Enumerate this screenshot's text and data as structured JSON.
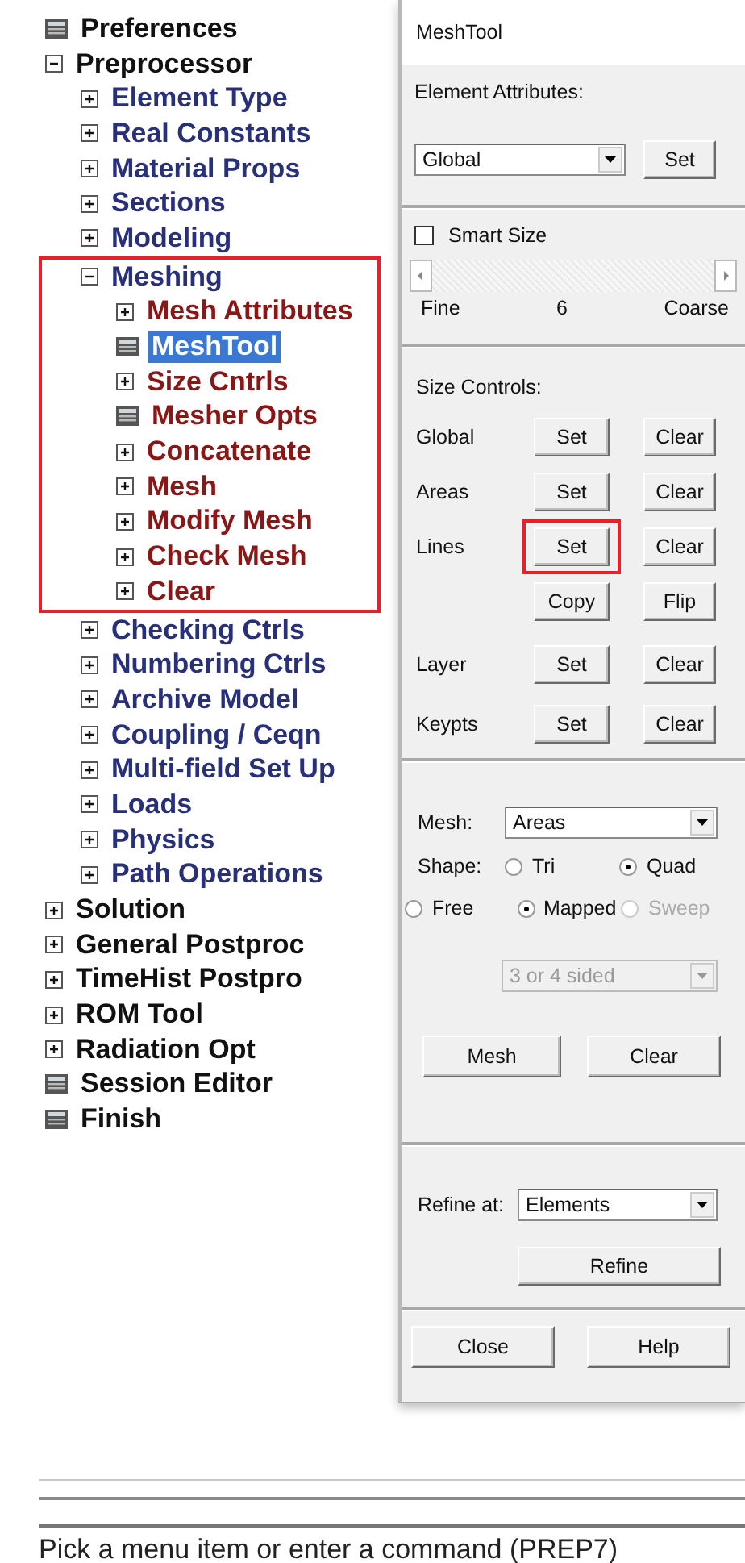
{
  "tree": [
    {
      "label": "Preferences",
      "kind": "dialog",
      "selected": false,
      "highlighted": false
    },
    {
      "label": "Preprocessor",
      "kind": "expander",
      "expanded": true,
      "selected": false,
      "highlighted": false,
      "children": [
        {
          "label": "Element Type",
          "kind": "expander",
          "expanded": false,
          "selected": false,
          "highlighted": false
        },
        {
          "label": "Real Constants",
          "kind": "expander",
          "expanded": false,
          "selected": false,
          "highlighted": false
        },
        {
          "label": "Material Props",
          "kind": "expander",
          "expanded": false,
          "selected": false,
          "highlighted": false
        },
        {
          "label": "Sections",
          "kind": "expander",
          "expanded": false,
          "selected": false,
          "highlighted": false
        },
        {
          "label": "Modeling",
          "kind": "expander",
          "expanded": false,
          "selected": false,
          "highlighted": false
        },
        {
          "label": "Meshing",
          "kind": "expander",
          "expanded": true,
          "selected": false,
          "highlighted": true,
          "children": [
            {
              "label": "Mesh Attributes",
              "kind": "expander",
              "expanded": false,
              "selected": false,
              "highlighted": false
            },
            {
              "label": "MeshTool",
              "kind": "dialog",
              "selected": true,
              "highlighted": false
            },
            {
              "label": "Size Cntrls",
              "kind": "expander",
              "expanded": false,
              "selected": false,
              "highlighted": false
            },
            {
              "label": "Mesher Opts",
              "kind": "dialog",
              "selected": false,
              "highlighted": false
            },
            {
              "label": "Concatenate",
              "kind": "expander",
              "expanded": false,
              "selected": false,
              "highlighted": false
            },
            {
              "label": "Mesh",
              "kind": "expander",
              "expanded": false,
              "selected": false,
              "highlighted": false
            },
            {
              "label": "Modify Mesh",
              "kind": "expander",
              "expanded": false,
              "selected": false,
              "highlighted": false
            },
            {
              "label": "Check Mesh",
              "kind": "expander",
              "expanded": false,
              "selected": false,
              "highlighted": false
            },
            {
              "label": "Clear",
              "kind": "expander",
              "expanded": false,
              "selected": false,
              "highlighted": false
            }
          ]
        },
        {
          "label": "Checking Ctrls",
          "kind": "expander",
          "expanded": false,
          "selected": false,
          "highlighted": false
        },
        {
          "label": "Numbering Ctrls",
          "kind": "expander",
          "expanded": false,
          "selected": false,
          "highlighted": false
        },
        {
          "label": "Archive Model",
          "kind": "expander",
          "expanded": false,
          "selected": false,
          "highlighted": false
        },
        {
          "label": "Coupling / Ceqn",
          "kind": "expander",
          "expanded": false,
          "selected": false,
          "highlighted": false
        },
        {
          "label": "Multi-field Set Up",
          "kind": "expander",
          "expanded": false,
          "selected": false,
          "highlighted": false
        },
        {
          "label": "Loads",
          "kind": "expander",
          "expanded": false,
          "selected": false,
          "highlighted": false
        },
        {
          "label": "Physics",
          "kind": "expander",
          "expanded": false,
          "selected": false,
          "highlighted": false
        },
        {
          "label": "Path Operations",
          "kind": "expander",
          "expanded": false,
          "selected": false,
          "highlighted": false
        }
      ]
    },
    {
      "label": "Solution",
      "kind": "expander",
      "expanded": false,
      "selected": false,
      "highlighted": false
    },
    {
      "label": "General Postproc",
      "kind": "expander",
      "expanded": false,
      "selected": false,
      "highlighted": false
    },
    {
      "label": "TimeHist Postpro",
      "kind": "expander",
      "expanded": false,
      "selected": false,
      "highlighted": false
    },
    {
      "label": "ROM Tool",
      "kind": "expander",
      "expanded": false,
      "selected": false,
      "highlighted": false
    },
    {
      "label": "Radiation Opt",
      "kind": "expander",
      "expanded": false,
      "selected": false,
      "highlighted": false
    },
    {
      "label": "Session Editor",
      "kind": "dialog",
      "selected": false,
      "highlighted": false
    },
    {
      "label": "Finish",
      "kind": "dialog",
      "selected": false,
      "highlighted": false
    }
  ],
  "mesh_tool": {
    "title": "MeshTool",
    "element_attributes": {
      "label": "Element Attributes:",
      "dropdown": {
        "value": "Global",
        "disabled": false
      },
      "button": {
        "label": "Set",
        "highlighted": false
      }
    },
    "smart_size": {
      "label": "Smart Size",
      "checked": false,
      "scale": [
        "Fine",
        "6",
        "Coarse"
      ]
    },
    "size_controls": {
      "label": "Size Controls:",
      "rows": [
        {
          "label": "Global",
          "buttons": [
            {
              "label": "Set",
              "highlighted": false
            },
            {
              "label": "Clear",
              "highlighted": false
            }
          ]
        },
        {
          "label": "Areas",
          "buttons": [
            {
              "label": "Set",
              "highlighted": false
            },
            {
              "label": "Clear",
              "highlighted": false
            }
          ]
        },
        {
          "label": "Lines",
          "buttons": [
            {
              "label": "Set",
              "highlighted": true
            },
            {
              "label": "Clear",
              "highlighted": false
            }
          ]
        },
        {
          "buttons": [
            {
              "label": "Copy",
              "highlighted": false
            },
            {
              "label": "Flip",
              "highlighted": false
            }
          ]
        },
        {
          "label": "Layer",
          "buttons": [
            {
              "label": "Set",
              "highlighted": false
            },
            {
              "label": "Clear",
              "highlighted": false
            }
          ]
        },
        {
          "label": "Keypts",
          "buttons": [
            {
              "label": "Set",
              "highlighted": false
            },
            {
              "label": "Clear",
              "highlighted": false
            }
          ]
        }
      ]
    },
    "mesh": {
      "label": "Mesh:",
      "dropdown": {
        "value": "Areas",
        "disabled": false
      },
      "shape": {
        "label": "Shape:",
        "options": [
          {
            "label": "Tri",
            "selected": false,
            "disabled": false
          },
          {
            "label": "Quad",
            "selected": true,
            "disabled": false
          }
        ]
      },
      "method": {
        "options": [
          {
            "label": "Free",
            "selected": false,
            "disabled": false
          },
          {
            "label": "Mapped",
            "selected": true,
            "disabled": false
          },
          {
            "label": "Sweep",
            "selected": false,
            "disabled": true
          }
        ]
      },
      "sides_dropdown": {
        "value": "3 or 4 sided",
        "disabled": true
      },
      "buttons": [
        {
          "label": "Mesh",
          "highlighted": false
        },
        {
          "label": "Clear",
          "highlighted": false
        }
      ]
    },
    "refine": {
      "label": "Refine at:",
      "dropdown": {
        "value": "Elements",
        "disabled": false
      },
      "button": {
        "label": "Refine",
        "highlighted": false
      }
    },
    "buttons": [
      {
        "label": "Close",
        "highlighted": false
      },
      {
        "label": "Help",
        "highlighted": false
      }
    ]
  },
  "status_bar": {
    "text": "Pick a menu item or enter a command (PREP7)"
  }
}
